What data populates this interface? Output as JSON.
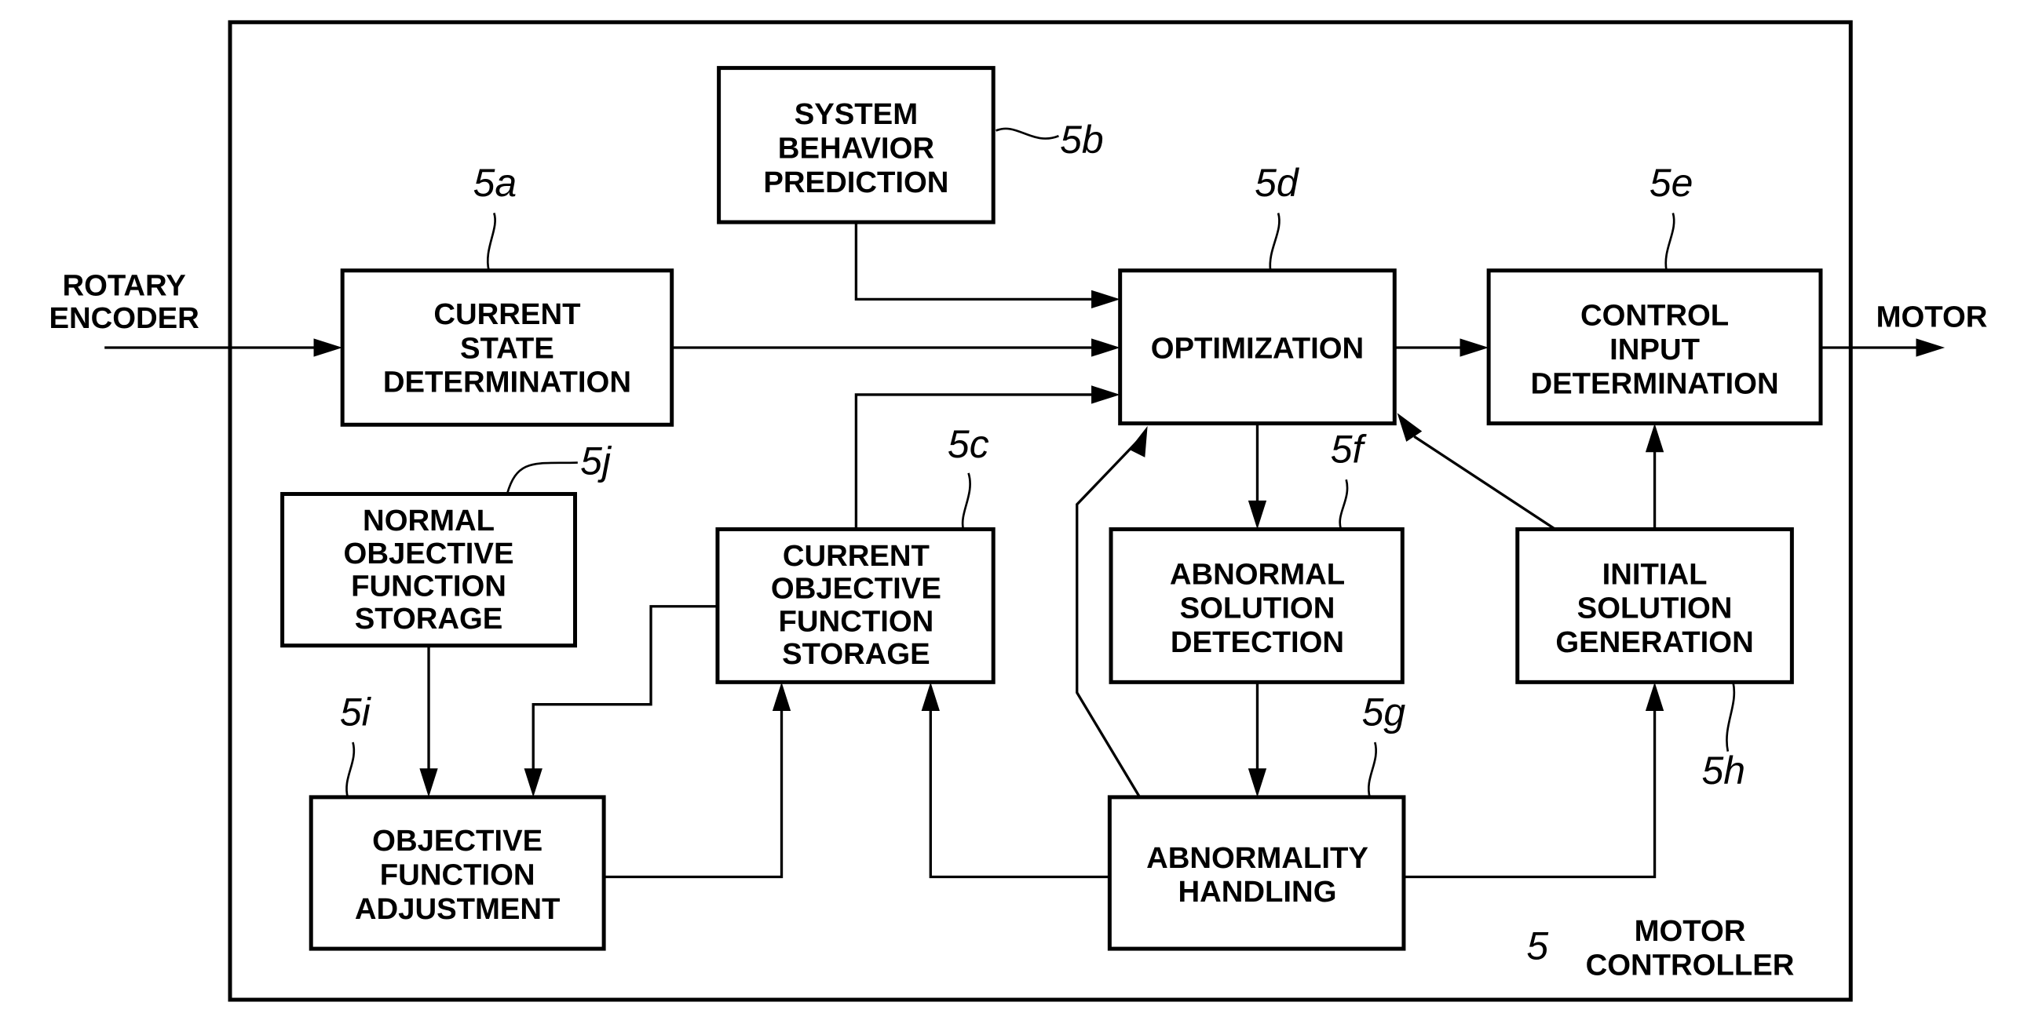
{
  "figure": {
    "container_label": [
      "MOTOR",
      "CONTROLLER"
    ],
    "container_ref": "5",
    "inputs": {
      "rotary_encoder": [
        "ROTARY",
        "ENCODER"
      ]
    },
    "outputs": {
      "motor": "MOTOR"
    }
  },
  "blocks": {
    "a": {
      "ref": "5a",
      "lines": [
        "CURRENT",
        "STATE",
        "DETERMINATION"
      ]
    },
    "b": {
      "ref": "5b",
      "lines": [
        "SYSTEM",
        "BEHAVIOR",
        "PREDICTION"
      ]
    },
    "c": {
      "ref": "5c",
      "lines": [
        "CURRENT",
        "OBJECTIVE",
        "FUNCTION",
        "STORAGE"
      ]
    },
    "d": {
      "ref": "5d",
      "lines": [
        "OPTIMIZATION"
      ]
    },
    "e": {
      "ref": "5e",
      "lines": [
        "CONTROL",
        "INPUT",
        "DETERMINATION"
      ]
    },
    "f": {
      "ref": "5f",
      "lines": [
        "ABNORMAL",
        "SOLUTION",
        "DETECTION"
      ]
    },
    "g": {
      "ref": "5g",
      "lines": [
        "ABNORMALITY",
        "HANDLING"
      ]
    },
    "h": {
      "ref": "5h",
      "lines": [
        "INITIAL",
        "SOLUTION",
        "GENERATION"
      ]
    },
    "i": {
      "ref": "5i",
      "lines": [
        "OBJECTIVE",
        "FUNCTION",
        "ADJUSTMENT"
      ]
    },
    "j": {
      "ref": "5j",
      "lines": [
        "NORMAL",
        "OBJECTIVE",
        "FUNCTION",
        "STORAGE"
      ]
    }
  },
  "connections": [
    {
      "from": "rotary_encoder",
      "to": "a"
    },
    {
      "from": "a",
      "to": "d"
    },
    {
      "from": "b",
      "to": "d"
    },
    {
      "from": "c",
      "to": "d"
    },
    {
      "from": "d",
      "to": "e"
    },
    {
      "from": "e",
      "to": "motor"
    },
    {
      "from": "d",
      "to": "f"
    },
    {
      "from": "f",
      "to": "g"
    },
    {
      "from": "g",
      "to": "d"
    },
    {
      "from": "g",
      "to": "c"
    },
    {
      "from": "g",
      "to": "h"
    },
    {
      "from": "h",
      "to": "d"
    },
    {
      "from": "h",
      "to": "e"
    },
    {
      "from": "j",
      "to": "i"
    },
    {
      "from": "c",
      "to": "i"
    },
    {
      "from": "i",
      "to": "c"
    }
  ]
}
